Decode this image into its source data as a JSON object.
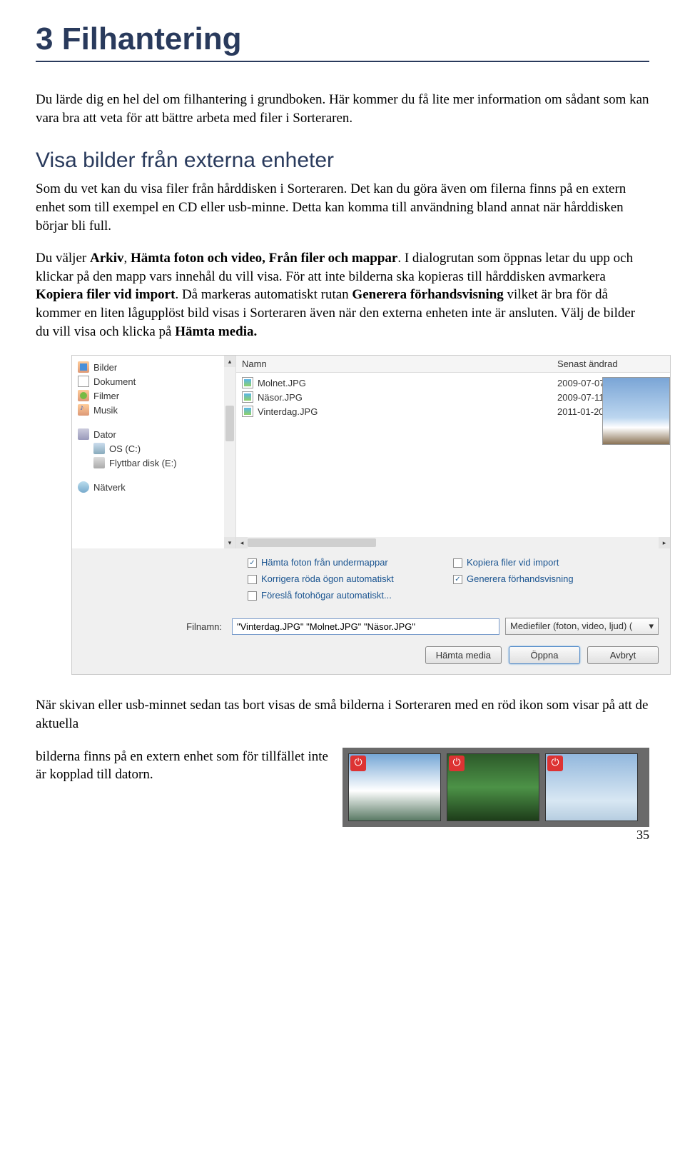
{
  "chapter": {
    "title": "3  Filhantering"
  },
  "intro": "Du lärde dig en hel del om filhantering i grundboken. Här kommer du få lite mer information om sådant som kan vara bra att veta för att bättre arbeta med filer i Sorteraren.",
  "section": {
    "title": "Visa bilder från externa enheter"
  },
  "para1": "Som du vet kan du visa filer från hårddisken i Sorteraren. Det kan du göra även om filerna finns på en extern enhet som till exempel en CD eller usb-minne. Detta kan komma till användning bland annat när hårddisken börjar bli full.",
  "para2a": "Du väljer ",
  "para2b": "Arkiv",
  "para2c": ", ",
  "para2d": "Hämta foton och video, Från filer och mappar",
  "para2e": ". I dialogru­tan som öppnas letar du upp och klickar på den mapp vars innehål du vill visa. För att inte bilderna ska kopieras till hårddisken avmarkera ",
  "para2f": "Kopiera filer vid import",
  "para2g": ". Då markeras automatiskt rutan ",
  "para2h": "Generera förhandsvisning",
  "para2i": " vilket är bra för då kommer en liten lågupplöst bild visas i Sorteraren även när den externa enheten inte är ansluten. Välj de bilder du vill visa och klicka på ",
  "para2j": "Hämta media.",
  "dialog": {
    "tree": [
      {
        "icon": "icon-folder-pic",
        "label": "Bilder",
        "indent": false
      },
      {
        "icon": "icon-doc",
        "label": "Dokument",
        "indent": false
      },
      {
        "icon": "icon-folder-vid",
        "label": "Filmer",
        "indent": false
      },
      {
        "icon": "icon-folder-music",
        "label": "Musik",
        "indent": false
      }
    ],
    "tree2": [
      {
        "icon": "icon-computer",
        "label": "Dator",
        "indent": false
      },
      {
        "icon": "icon-disk",
        "label": "OS (C:)",
        "indent": true
      },
      {
        "icon": "icon-usb",
        "label": "Flyttbar disk (E:)",
        "indent": true
      }
    ],
    "tree3": [
      {
        "icon": "icon-network",
        "label": "Nätverk",
        "indent": false
      }
    ],
    "headers": {
      "name": "Namn",
      "date": "Senast ändrad"
    },
    "files": [
      {
        "name": "Molnet.JPG",
        "date": "2009-07-07 17"
      },
      {
        "name": "Näsor.JPG",
        "date": "2009-07-11 15"
      },
      {
        "name": "Vinterdag.JPG",
        "date": "2011-01-20 14"
      }
    ],
    "options": {
      "left": [
        {
          "checked": true,
          "label": "Hämta foton från undermappar"
        },
        {
          "checked": false,
          "label": "Korrigera röda ögon automatiskt"
        },
        {
          "checked": false,
          "label": "Föreslå fotohögar automatiskt..."
        }
      ],
      "right": [
        {
          "checked": false,
          "label": "Kopiera filer vid import"
        },
        {
          "checked": true,
          "label": "Generera förhandsvisning"
        }
      ]
    },
    "filename_label": "Filnamn:",
    "filename_value": "\"Vinterdag.JPG\" \"Molnet.JPG\" \"Näsor.JPG\"",
    "filetype": "Mediefiler (foton, video, ljud) (",
    "buttons": {
      "fetch": "Hämta media",
      "open": "Öppna",
      "cancel": "Avbryt"
    }
  },
  "after1": "När skivan eller usb-minnet sedan tas bort visas de små bilderna i Sorteraren med en röd ikon som visar på att de aktuella",
  "after2": "bilderna finns på en extern enhet som för tillfället inte är kopplad till datorn.",
  "page_number": "35"
}
